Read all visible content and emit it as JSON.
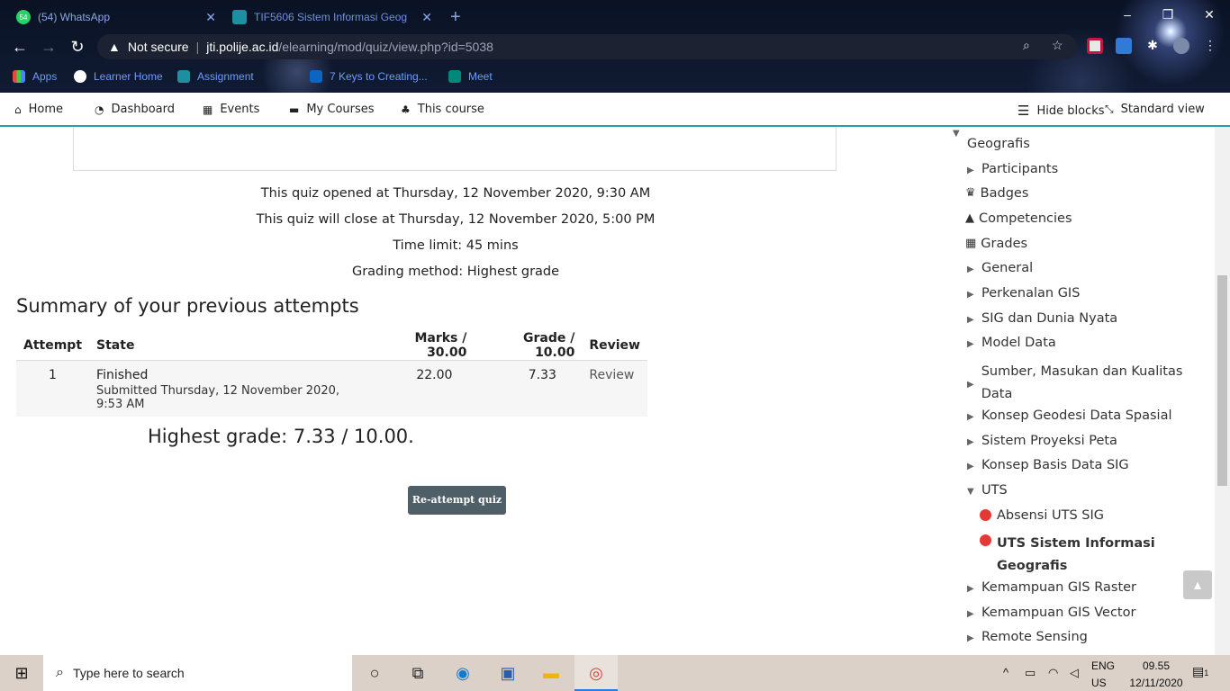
{
  "browser": {
    "tabs": [
      {
        "title": "(54) WhatsApp",
        "badge": "54"
      },
      {
        "title": "TIF5606 Sistem Informasi Geografis"
      }
    ],
    "new_tab": "+",
    "window_buttons": [
      "–",
      "❐",
      "✕"
    ],
    "address": {
      "warning": "Not secure",
      "host": "jti.polije.ac.id",
      "path": "/elearning/mod/quiz/view.php?id=5038"
    },
    "bookmarks": [
      "Apps",
      "Learner Home",
      "Assignment",
      "7 Keys to Creating...",
      "Meet"
    ]
  },
  "navbar": {
    "items": [
      "Home",
      "Dashboard",
      "Events",
      "My Courses",
      "This course"
    ],
    "hide_blocks": "Hide blocks",
    "standard_view": "Standard view"
  },
  "quiz": {
    "info": [
      "This quiz opened at Thursday, 12 November 2020, 9:30 AM",
      "This quiz will close at Thursday, 12 November 2020, 5:00 PM",
      "Time limit: 45 mins",
      "Grading method: Highest grade"
    ],
    "summary_title": "Summary of your previous attempts",
    "table": {
      "headers": [
        "Attempt",
        "State",
        "Marks / 30.00",
        "Grade / 10.00",
        "Review"
      ],
      "rows": [
        {
          "attempt": "1",
          "state": "Finished",
          "submitted": "Submitted Thursday, 12 November 2020, 9:53 AM",
          "marks": "22.00",
          "grade": "7.33",
          "review": "Review"
        }
      ]
    },
    "highest_grade": "Highest grade: 7.33 / 10.00.",
    "reattempt_button": "Re-attempt quiz"
  },
  "sidebar": {
    "course": "Geografis",
    "items": [
      "Participants",
      "Badges",
      "Competencies",
      "Grades",
      "General",
      "Perkenalan GIS",
      "SIG dan Dunia Nyata",
      "Model Data",
      "Sumber, Masukan dan Kualitas Data",
      "Konsep Geodesi Data Spasial",
      "Sistem Proyeksi Peta",
      "Konsep Basis Data SIG",
      "UTS"
    ],
    "uts_children": [
      "Absensi UTS SIG",
      "UTS Sistem Informasi Geografis"
    ],
    "after": [
      "Kemampuan GIS Raster",
      "Kemampuan GIS Vector",
      "Remote Sensing"
    ]
  },
  "taskbar": {
    "search_placeholder": "Type here to search",
    "lang": "ENG",
    "region": "US",
    "time": "09.55",
    "date": "12/11/2020",
    "notification_count": "1"
  },
  "colors": {
    "accent": "#1fa3a8",
    "button": "#4f5f68",
    "link_blue": "#6e9bff"
  }
}
